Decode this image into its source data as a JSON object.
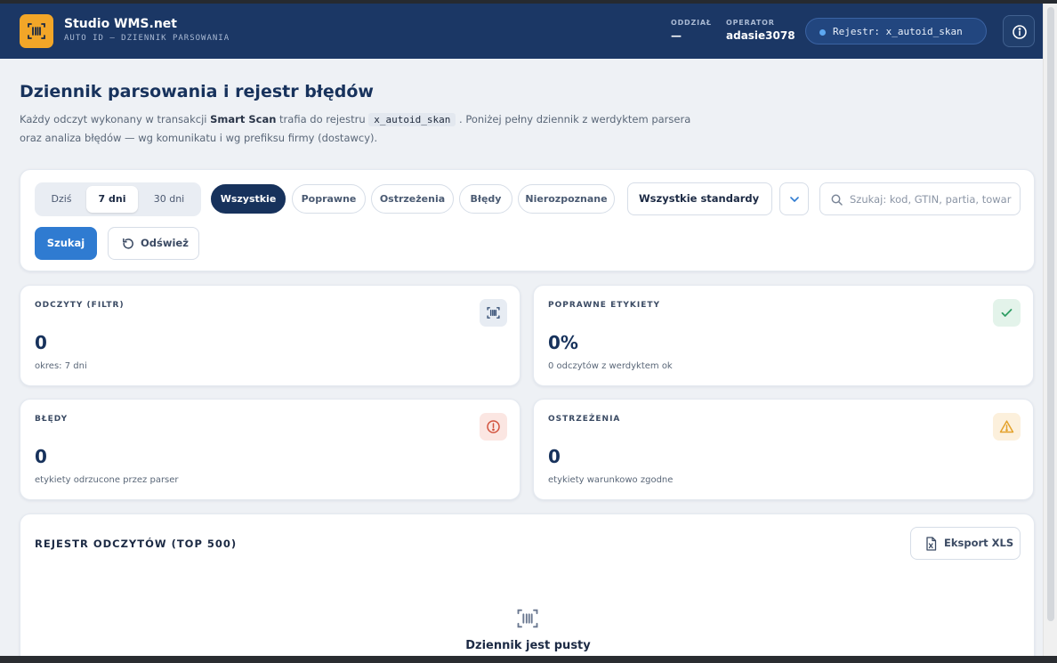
{
  "app": {
    "name": "Studio WMS.net",
    "subtitle": "AUTO ID — DZIENNIK PARSOWANIA",
    "branch_label": "ODDZIAŁ",
    "branch_value": "—",
    "operator_label": "OPERATOR",
    "operator_value": "adasie3078",
    "registry_pill": "Rejestr: x_autoid_skan"
  },
  "page": {
    "title": "Dziennik parsowania i rejestr błędów",
    "desc_part1": "Każdy odczyt wykonany w transakcji ",
    "desc_bold": "Smart Scan",
    "desc_part2": " trafia do rejestru ",
    "desc_code": "x_autoid_skan",
    "desc_part3": " . Poniżej pełny dziennik z werdyktem parsera",
    "desc_line2": "oraz analiza błędów — wg komunikatu i wg prefiksu firmy (dostawcy)."
  },
  "filters": {
    "periods": [
      "Dziś",
      "7 dni",
      "30 dni"
    ],
    "active_period": "7 dni",
    "verdicts": [
      "Wszystkie",
      "Poprawne",
      "Ostrzeżenia",
      "Błędy",
      "Nierozpoznane"
    ],
    "active_verdict": "Wszystkie",
    "standard_select": "Wszystkie standardy",
    "search_placeholder": "Szukaj: kod, GTIN, partia, towar",
    "search_button": "Szukaj",
    "refresh_button": "Odśwież"
  },
  "stats": {
    "reads": {
      "label": "ODCZYTY (FILTR)",
      "value": "0",
      "sub": "okres: 7 dni",
      "icon": "barcode-icon"
    },
    "valid": {
      "label": "POPRAWNE ETYKIETY",
      "value": "0%",
      "sub": "0 odczytów z werdyktem ok",
      "icon": "check-icon"
    },
    "errors": {
      "label": "BŁĘDY",
      "value": "0",
      "sub": "etykiety odrzucone przez parser",
      "icon": "alert-circle-icon"
    },
    "warnings": {
      "label": "OSTRZEŻENIA",
      "value": "0",
      "sub": "etykiety warunkowo zgodne",
      "icon": "warning-triangle-icon"
    }
  },
  "registry": {
    "title": "REJESTR ODCZYTÓW (TOP 500)",
    "export_button": "Eksport XLS",
    "empty_title": "Dziennik jest pusty"
  },
  "colors": {
    "header_bg": "#1b3765",
    "logo_accent": "#f2a628",
    "primary": "#2f7bd1",
    "navy": "#17325c",
    "success": "#2e9d63",
    "error": "#d2533e",
    "warning": "#e3a22b"
  }
}
